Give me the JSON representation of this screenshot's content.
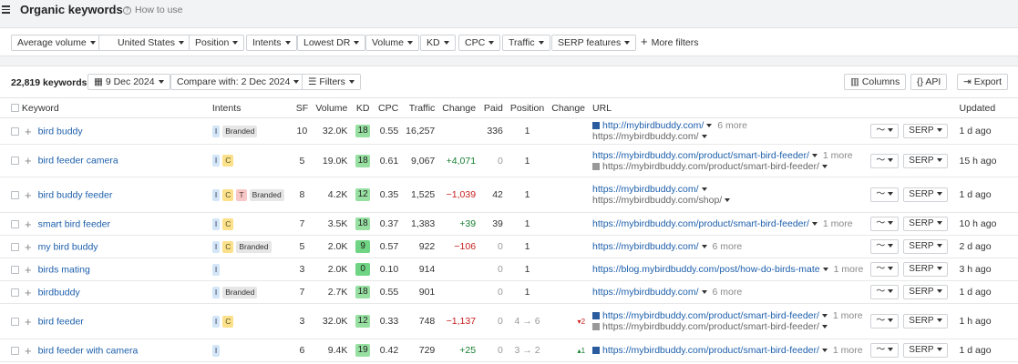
{
  "header": {
    "title": "Organic keywords",
    "howto": "How to use"
  },
  "filters": [
    "Average volume",
    "United States",
    "Position",
    "Intents",
    "Lowest DR",
    "Volume",
    "KD",
    "CPC",
    "Traffic",
    "SERP features"
  ],
  "more_filters": "More filters",
  "toolbar": {
    "keyword_count": "22,819 keywords",
    "date": "9 Dec 2024",
    "compare": "Compare with: 2 Dec 2024",
    "filters": "Filters",
    "columns": "Columns",
    "api": "API",
    "export": "Export"
  },
  "columns": [
    "Keyword",
    "Intents",
    "SF",
    "Volume",
    "KD",
    "CPC",
    "Traffic",
    "Change",
    "Paid",
    "Position",
    "Change",
    "URL",
    "Updated"
  ],
  "rows": [
    {
      "keyword": "bird buddy",
      "intents": [
        "I"
      ],
      "branded": "Branded",
      "sf": "10",
      "volume": "32.0K",
      "kd": "18",
      "cpc": "0.55",
      "traffic": "16,257",
      "change": "",
      "paid": "336",
      "position": "1",
      "poschange": "",
      "url": "http://mybirdbuddy.com/",
      "url_more": "6 more",
      "url2": "https://mybirdbuddy.com/",
      "updated": "1 d ago"
    },
    {
      "keyword": "bird feeder camera",
      "intents": [
        "I",
        "C"
      ],
      "branded": "",
      "sf": "5",
      "volume": "19.0K",
      "kd": "18",
      "cpc": "0.61",
      "traffic": "9,067",
      "change": "+4,071",
      "paid": "0",
      "position": "1",
      "poschange": "",
      "url": "https://mybirdbuddy.com/product/smart-bird-feeder/",
      "url_more": "1 more",
      "url2": "https://mybirdbuddy.com/product/smart-bird-feeder/",
      "updated": "15 h ago"
    },
    {
      "keyword": "bird buddy feeder",
      "intents": [
        "I",
        "C",
        "T"
      ],
      "branded": "Branded",
      "sf": "8",
      "volume": "4.2K",
      "kd": "12",
      "cpc": "0.35",
      "traffic": "1,525",
      "change": "−1,039",
      "paid": "42",
      "position": "1",
      "poschange": "",
      "url": "https://mybirdbuddy.com/",
      "url_more": "",
      "url2": "https://mybirdbuddy.com/shop/",
      "updated": "1 d ago"
    },
    {
      "keyword": "smart bird feeder",
      "intents": [
        "I",
        "C"
      ],
      "branded": "",
      "sf": "7",
      "volume": "3.5K",
      "kd": "18",
      "cpc": "0.37",
      "traffic": "1,383",
      "change": "+39",
      "paid": "39",
      "position": "1",
      "poschange": "",
      "url": "https://mybirdbuddy.com/product/smart-bird-feeder/",
      "url_more": "1 more",
      "url2": "",
      "updated": "10 h ago"
    },
    {
      "keyword": "my bird buddy",
      "intents": [
        "I",
        "C"
      ],
      "branded": "Branded",
      "sf": "5",
      "volume": "2.0K",
      "kd": "9",
      "cpc": "0.57",
      "traffic": "922",
      "change": "−106",
      "paid": "0",
      "position": "1",
      "poschange": "",
      "url": "https://mybirdbuddy.com/",
      "url_more": "6 more",
      "url2": "",
      "updated": "2 d ago"
    },
    {
      "keyword": "birds mating",
      "intents": [
        "I"
      ],
      "branded": "",
      "sf": "3",
      "volume": "2.0K",
      "kd": "0",
      "cpc": "0.10",
      "traffic": "914",
      "change": "",
      "paid": "0",
      "position": "1",
      "poschange": "",
      "url": "https://blog.mybirdbuddy.com/post/how-do-birds-mate",
      "url_more": "1 more",
      "url2": "",
      "updated": "3 h ago"
    },
    {
      "keyword": "birdbuddy",
      "intents": [
        "I"
      ],
      "branded": "Branded",
      "sf": "7",
      "volume": "2.7K",
      "kd": "18",
      "cpc": "0.55",
      "traffic": "901",
      "change": "",
      "paid": "0",
      "position": "1",
      "poschange": "",
      "url": "https://mybirdbuddy.com/",
      "url_more": "6 more",
      "url2": "",
      "updated": "1 d ago"
    },
    {
      "keyword": "bird feeder",
      "intents": [
        "I",
        "C"
      ],
      "branded": "",
      "sf": "3",
      "volume": "32.0K",
      "kd": "12",
      "cpc": "0.33",
      "traffic": "748",
      "change": "−1,137",
      "paid": "0",
      "position": "4 → 6",
      "poschange": "▾2",
      "url": "https://mybirdbuddy.com/product/smart-bird-feeder/",
      "url_more": "1 more",
      "url2": "https://mybirdbuddy.com/product/smart-bird-feeder/",
      "updated": "1 h ago"
    },
    {
      "keyword": "bird feeder with camera",
      "intents": [
        "I"
      ],
      "branded": "",
      "sf": "6",
      "volume": "9.4K",
      "kd": "19",
      "cpc": "0.42",
      "traffic": "729",
      "change": "+25",
      "paid": "0",
      "position": "3 → 2",
      "poschange": "▴1",
      "url": "https://mybirdbuddy.com/product/smart-bird-feeder/",
      "url_more": "1 more",
      "url2": "",
      "updated": "1 d ago"
    }
  ],
  "serp_label": "SERP"
}
